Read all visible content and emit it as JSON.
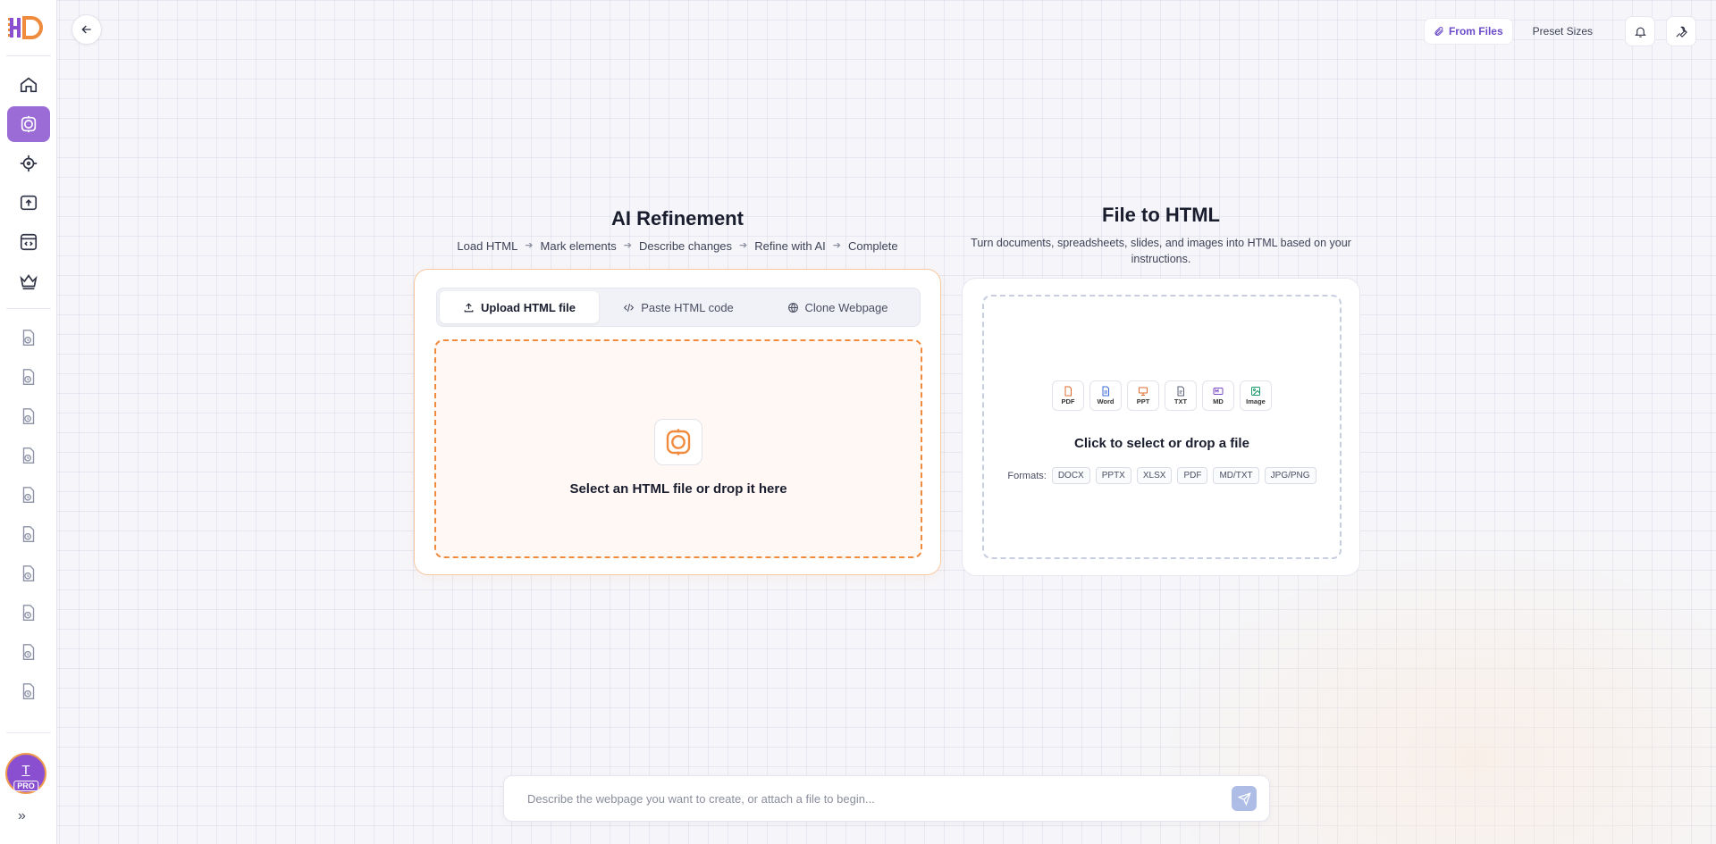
{
  "topbar": {
    "from_files": "From Files",
    "preset_sizes": "Preset Sizes"
  },
  "refine": {
    "title": "AI Refinement",
    "steps": [
      "Load HTML",
      "Mark elements",
      "Describe changes",
      "Refine with AI",
      "Complete"
    ],
    "tabs": [
      "Upload HTML file",
      "Paste HTML code",
      "Clone Webpage"
    ],
    "drop_text": "Select an HTML file or drop it here"
  },
  "file_to_html": {
    "title": "File to HTML",
    "subtitle": "Turn documents, spreadsheets, slides, and images into HTML based on your instructions.",
    "icons": [
      "PDF",
      "Word",
      "PPT",
      "TXT",
      "MD",
      "Image"
    ],
    "drop_text": "Click to select or drop a file",
    "formats_label": "Formats:",
    "formats": [
      "DOCX",
      "PPTX",
      "XLSX",
      "PDF",
      "MD/TXT",
      "JPG/PNG"
    ]
  },
  "user": {
    "initial": "T",
    "badge": "PRO"
  },
  "prompt": {
    "placeholder": "Describe the webpage you want to create, or attach a file to begin..."
  },
  "colors": {
    "accent_purple": "#9b6bd6",
    "accent_orange": "#f08a3c"
  }
}
